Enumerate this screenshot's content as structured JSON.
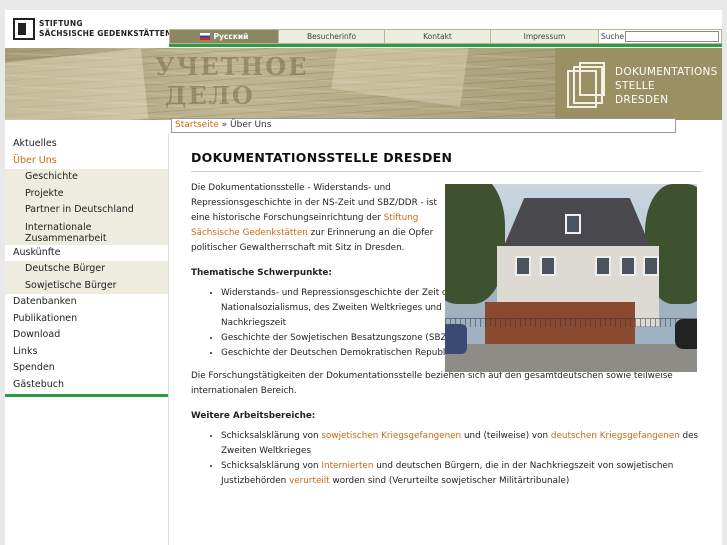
{
  "logo": {
    "line1": "STIFTUNG",
    "line2": "SÄCHSISCHE GEDENKSTÄTTEN"
  },
  "topnav": {
    "items": [
      "Русский",
      "Besucherinfo",
      "Kontakt",
      "Impressum"
    ],
    "search_label": "Suche",
    "search_value": ""
  },
  "banner": {
    "stamp1": "УЧЕТНОЕ",
    "stamp2": "ДЕЛО",
    "title_lines": [
      "DOKUMENTATIONS",
      "STELLE",
      "DRESDEN"
    ]
  },
  "breadcrumb": {
    "home": "Startseite",
    "sep": "»",
    "current": "Über Uns"
  },
  "sidebar": {
    "items": [
      {
        "label": "Aktuelles",
        "level": 0
      },
      {
        "label": "Über Uns",
        "level": 0,
        "active": true
      },
      {
        "label": "Geschichte",
        "level": 1
      },
      {
        "label": "Projekte",
        "level": 1
      },
      {
        "label": "Partner in Deutschland",
        "level": 1
      },
      {
        "label": "Internationale Zusammenarbeit",
        "level": 1
      },
      {
        "label": "Auskünfte",
        "level": 0
      },
      {
        "label": "Deutsche Bürger",
        "level": 1
      },
      {
        "label": "Sowjetische Bürger",
        "level": 1
      },
      {
        "label": "Datenbanken",
        "level": 0
      },
      {
        "label": "Publikationen",
        "level": 0
      },
      {
        "label": "Download",
        "level": 0
      },
      {
        "label": "Links",
        "level": 0
      },
      {
        "label": "Spenden",
        "level": 0
      },
      {
        "label": "Gästebuch",
        "level": 0
      }
    ]
  },
  "main": {
    "title": "DOKUMENTATIONSSTELLE DRESDEN",
    "intro_a": "Die Dokumentationsstelle - Widerstands- und Repressionsgeschichte in der NS-Zeit und SBZ/DDR - ist eine historische Forschungseinrichtung der",
    "intro_link": "Stiftung Sächsische Gedenkstätten",
    "intro_b": "zur Erinnerung an die Opfer politischer Gewaltherrschaft mit Sitz in Dresden.",
    "heading1": "Thematische Schwerpunkte:",
    "list1": [
      "Widerstands- und Repressionsgeschichte der Zeit des Nationalsozialismus, des Zweiten Weltkrieges und der Nachkriegszeit",
      "Geschichte der Sowjetischen Besatzungszone (SBZ)",
      "Geschichte der Deutschen Demokratischen Republik (DDR)"
    ],
    "paragraph2": "Die Forschungstätigkeiten der Dokumentationsstelle beziehen sich auf den gesamtdeutschen sowie teilweise internationalen Bereich.",
    "heading2": "Weitere Arbeitsbereiche:",
    "list2": {
      "item1_a": "Schicksalsklärung von",
      "item1_link1": "sowjetischen Kriegsgefangenen",
      "item1_b": "und (teilweise) von",
      "item1_link2": "deutschen Kriegsgefangenen",
      "item1_c": "des Zweiten Weltkrieges",
      "item2_a": "Schicksalsklärung von",
      "item2_link1": "Internierten",
      "item2_b": "und deutschen Bürgern, die in der Nachkriegszeit von sowjetischen Justizbehörden",
      "item2_link2": "verurteilt",
      "item2_c": "worden sind (Verurteilte sowjetischer Militärtribunale)"
    }
  },
  "colors": {
    "accent": "#c96a16",
    "green": "#2f9a41",
    "khaki": "#8b8762",
    "banner": "#9b8f64"
  }
}
